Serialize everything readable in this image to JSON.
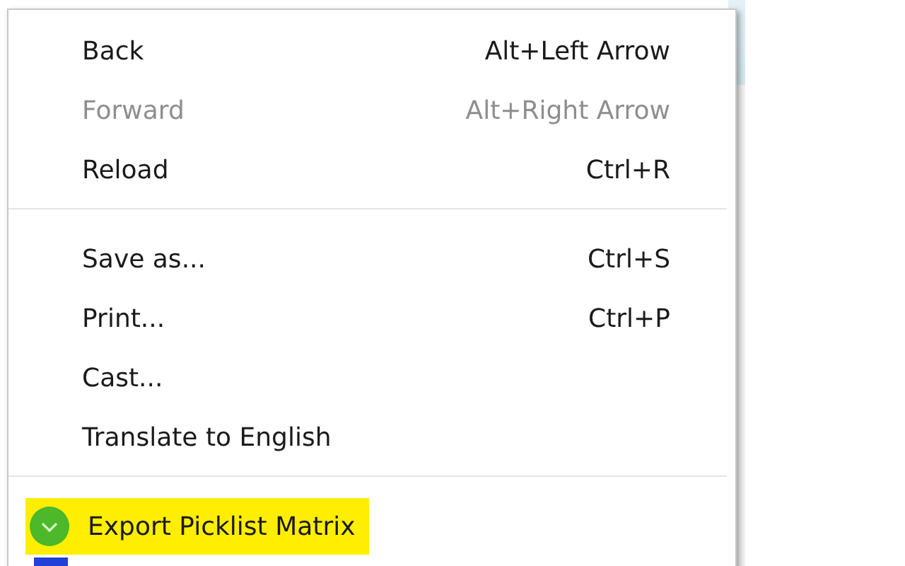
{
  "menu": {
    "groups": [
      {
        "items": [
          {
            "kind": "command",
            "label": "Back",
            "shortcut": "Alt+Left Arrow",
            "disabled": false
          },
          {
            "kind": "command",
            "label": "Forward",
            "shortcut": "Alt+Right Arrow",
            "disabled": true
          },
          {
            "kind": "command",
            "label": "Reload",
            "shortcut": "Ctrl+R",
            "disabled": false
          }
        ]
      },
      {
        "items": [
          {
            "kind": "command",
            "label": "Save as...",
            "shortcut": "Ctrl+S",
            "disabled": false
          },
          {
            "kind": "command",
            "label": "Print...",
            "shortcut": "Ctrl+P",
            "disabled": false
          },
          {
            "kind": "command",
            "label": "Cast...",
            "disabled": false
          },
          {
            "kind": "command",
            "label": "Translate to English",
            "disabled": false
          }
        ]
      },
      {
        "items": [
          {
            "kind": "extension",
            "label": "Export Picklist Matrix",
            "highlighted": true
          },
          {
            "kind": "extension_cut"
          }
        ]
      }
    ]
  }
}
